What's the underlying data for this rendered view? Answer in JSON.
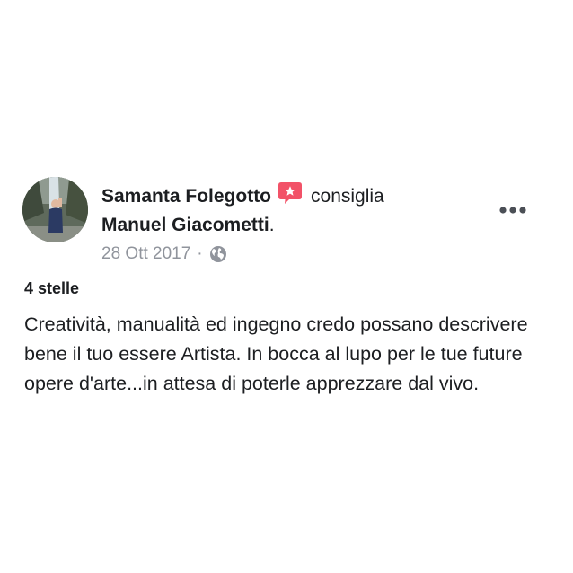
{
  "post": {
    "author_name": "Samanta Folegotto",
    "verb": "consiglia",
    "page_name": "Manuel Giacometti",
    "period": ".",
    "timestamp": "28 Ott 2017",
    "separator": "·",
    "rating": "4 stelle",
    "body": "Creatività, manualità ed ingegno credo possano descrivere bene il tuo essere Artista. In bocca al lupo per le tue future opere d'arte...in attesa di poterle apprezzare dal vivo."
  },
  "icons": {
    "recommend": "recommend-star-bubble-icon",
    "privacy": "globe-icon",
    "more": "more-options-icon",
    "avatar": "profile-photo"
  },
  "colors": {
    "recommend_accent": "#f25268",
    "meta_gray": "#90949c",
    "text": "#1c1e21"
  }
}
